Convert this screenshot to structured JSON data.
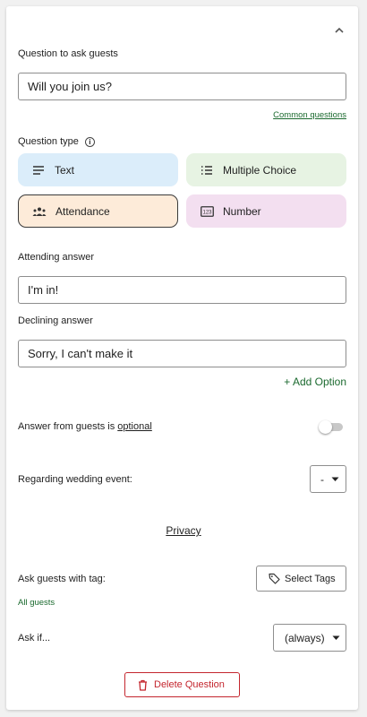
{
  "question": {
    "label": "Question to ask guests",
    "value": "Will you join us?",
    "common_questions_link": "Common questions"
  },
  "question_type": {
    "label": "Question type",
    "options": [
      {
        "label": "Text",
        "icon": "text-lines-icon",
        "selected": false
      },
      {
        "label": "Multiple Choice",
        "icon": "list-icon",
        "selected": false
      },
      {
        "label": "Attendance",
        "icon": "group-icon",
        "selected": true
      },
      {
        "label": "Number",
        "icon": "numbers-icon",
        "selected": false
      }
    ]
  },
  "attending_answer": {
    "label": "Attending answer",
    "value": "I'm in!"
  },
  "declining_answer": {
    "label": "Declining answer",
    "value": "Sorry, I can't make it"
  },
  "add_option": "+ Add Option",
  "optional_row": {
    "text": "Answer from guests is ",
    "link": "optional",
    "toggle_on": false
  },
  "wedding_event": {
    "label": "Regarding wedding event:",
    "selected": "-"
  },
  "privacy_link": "Privacy",
  "tags": {
    "label": "Ask guests with tag:",
    "button": "Select Tags",
    "value": "All guests"
  },
  "ask_if": {
    "label": "Ask if...",
    "selected": "(always)"
  },
  "delete_button": "Delete Question",
  "colors": {
    "accent_green": "#1b6a2f",
    "danger": "#c4262e"
  }
}
